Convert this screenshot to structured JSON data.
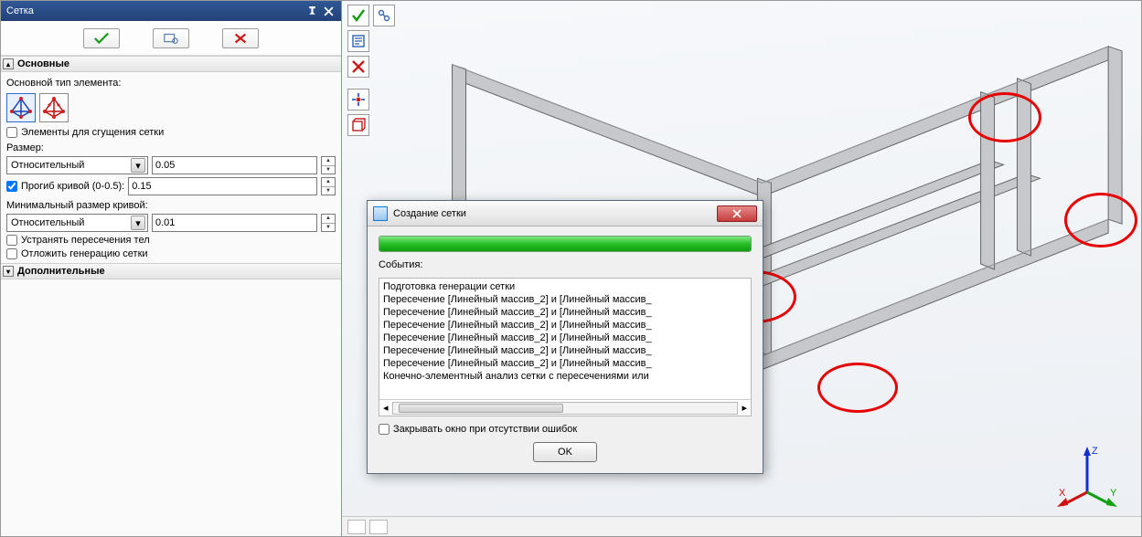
{
  "panel": {
    "title": "Сетка",
    "sections": {
      "main": "Основные",
      "additional": "Дополнительные"
    },
    "labels": {
      "elem_type": "Основной тип элемента:",
      "dense_elems": "Элементы для сгущения сетки",
      "size": "Размер:",
      "sag": "Прогиб кривой (0-0.5):",
      "min_curve": "Минимальный размер кривой:",
      "remove_inter": "Устранять пересечения тел",
      "delay_gen": "Отложить генерацию сетки"
    },
    "values": {
      "size_mode": "Относительный",
      "size_val": "0.05",
      "sag_val": "0.15",
      "min_mode": "Относительный",
      "min_val": "0.01"
    }
  },
  "dialog": {
    "title": "Создание сетки",
    "events_label": "События:",
    "events": [
      "Подготовка генерации сетки",
      "Пересечение [Линейный массив_2] и [Линейный массив_",
      "Пересечение [Линейный массив_2] и [Линейный массив_",
      "Пересечение [Линейный массив_2] и [Линейный массив_",
      "Пересечение [Линейный массив_2] и [Линейный массив_",
      "Пересечение [Линейный массив_2] и [Линейный массив_",
      "Пересечение [Линейный массив_2] и [Линейный массив_",
      "Конечно-элементный анализ сетки с пересечениями или"
    ],
    "close_on_no_errors": "Закрывать окно при отсутствии ошибок",
    "ok": "OK"
  },
  "triad": {
    "x": "X",
    "y": "Y",
    "z": "Z"
  }
}
